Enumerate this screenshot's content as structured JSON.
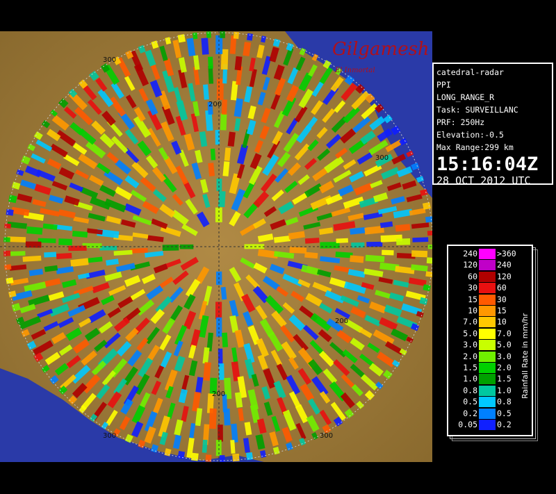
{
  "brand": {
    "logo_text": "Gilgamesh",
    "logo_subtext": "El Inmortal"
  },
  "info": {
    "radar_name": "catedral-radar",
    "scan_mode": "PPI",
    "range_mode": "LONG_RANGE_R",
    "task": "Task: SURVEILLANC",
    "prf": "PRF: 250Hz",
    "elevation": "Elevation:-0.5",
    "max_range": "Max Range:299 km",
    "time": "15:16:04Z",
    "date": "28 OCT 2012 UTC"
  },
  "map": {
    "range_labels": [
      "300",
      "200",
      "200",
      "300",
      "200",
      "300",
      "300"
    ],
    "colors": {
      "sea": "#2a3aa8",
      "land": "#a27d3a",
      "terrain_dark": "#6b5426"
    }
  },
  "legend": {
    "title": "Rainfall Rate in mm/hr",
    "rows": [
      {
        "low": "240",
        "high": ">360",
        "color": "#ff00ff"
      },
      {
        "low": "120",
        "high": "240",
        "color": "#c000c8"
      },
      {
        "low": "60",
        "high": "120",
        "color": "#b00000"
      },
      {
        "low": "30",
        "high": "60",
        "color": "#e81010"
      },
      {
        "low": "15",
        "high": "30",
        "color": "#ff5a00"
      },
      {
        "low": "10",
        "high": "15",
        "color": "#ff9800"
      },
      {
        "low": "7.0",
        "high": "10",
        "color": "#ffc800"
      },
      {
        "low": "5.0",
        "high": "7.0",
        "color": "#ffff00"
      },
      {
        "low": "3.0",
        "high": "5.0",
        "color": "#c8ff00"
      },
      {
        "low": "2.0",
        "high": "3.0",
        "color": "#70f000"
      },
      {
        "low": "1.5",
        "high": "2.0",
        "color": "#00d000"
      },
      {
        "low": "1.0",
        "high": "1.5",
        "color": "#00a000"
      },
      {
        "low": "0.8",
        "high": "1.0",
        "color": "#00c8a0"
      },
      {
        "low": "0.5",
        "high": "0.8",
        "color": "#00c8ff"
      },
      {
        "low": "0.2",
        "high": "0.5",
        "color": "#0080ff"
      },
      {
        "low": "0.05",
        "high": "0.2",
        "color": "#1020ff"
      }
    ]
  }
}
